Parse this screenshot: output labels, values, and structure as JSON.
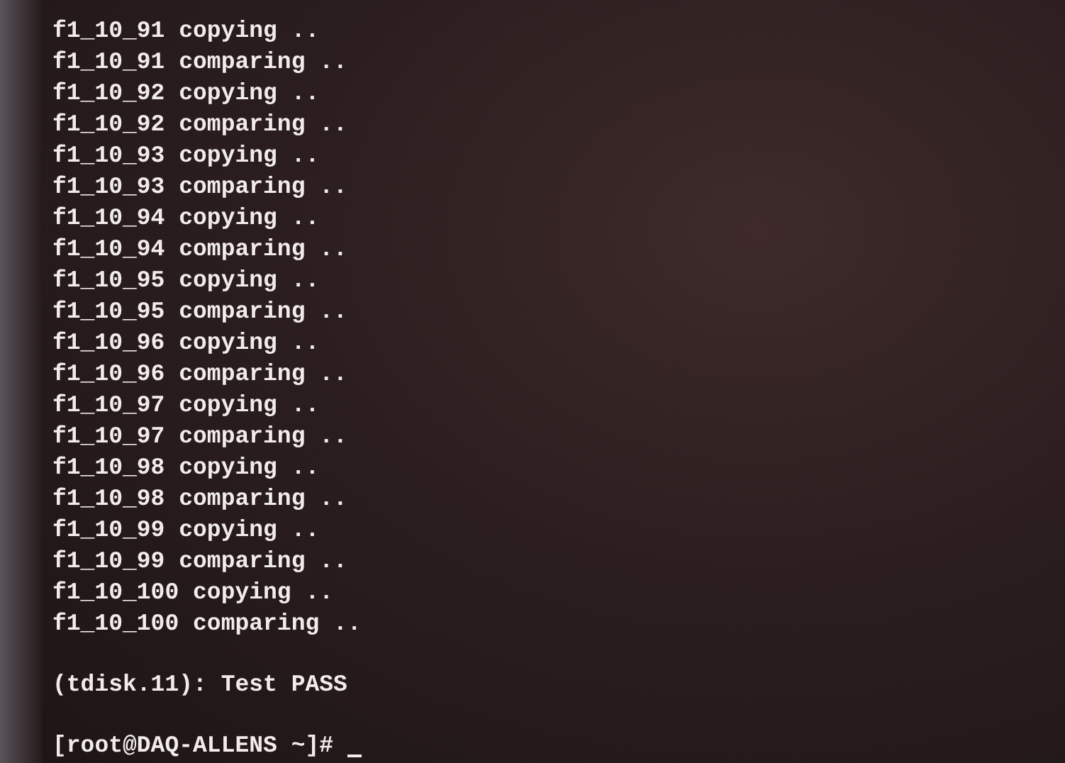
{
  "terminal": {
    "lines": [
      "f1_10_91 copying ..",
      "f1_10_91 comparing ..",
      "f1_10_92 copying ..",
      "f1_10_92 comparing ..",
      "f1_10_93 copying ..",
      "f1_10_93 comparing ..",
      "f1_10_94 copying ..",
      "f1_10_94 comparing ..",
      "f1_10_95 copying ..",
      "f1_10_95 comparing ..",
      "f1_10_96 copying ..",
      "f1_10_96 comparing ..",
      "f1_10_97 copying ..",
      "f1_10_97 comparing ..",
      "f1_10_98 copying ..",
      "f1_10_98 comparing ..",
      "f1_10_99 copying ..",
      "f1_10_99 comparing ..",
      "f1_10_100 copying ..",
      "f1_10_100 comparing .."
    ],
    "result": "(tdisk.11): Test PASS",
    "prompt": "[root@DAQ-ALLENS ~]#",
    "cursor": true
  }
}
